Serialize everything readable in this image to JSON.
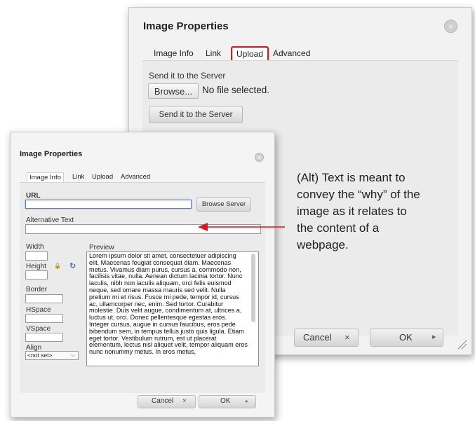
{
  "back_dialog": {
    "title": "Image Properties",
    "tabs": [
      "Image Info",
      "Link",
      "Upload",
      "Advanced"
    ],
    "active_tab": "Upload",
    "send_label": "Send it to the Server",
    "browse_label": "Browse...",
    "file_status": "No file selected.",
    "send_button_label": "Send it to the Server",
    "cancel_label": "Cancel",
    "cancel_icon": "×",
    "ok_label": "OK",
    "ok_icon": "▸"
  },
  "front_dialog": {
    "title": "Image Properties",
    "tabs": [
      "Image Info",
      "Link",
      "Upload",
      "Advanced"
    ],
    "active_tab": "Image Info",
    "url_label": "URL",
    "url_value": "",
    "browse_server_label": "Browse Server",
    "alt_text_label": "Alternative Text",
    "alt_text_value": "",
    "width_label": "Width",
    "height_label": "Height",
    "border_label": "Border",
    "hspace_label": "HSpace",
    "vspace_label": "VSpace",
    "align_label": "Align",
    "align_value": "<not set>",
    "preview_label": "Preview",
    "preview_text": "Lorem ipsum dolor sit amet, consectetuer adipiscing elit. Maecenas feugiat consequat diam. Maecenas metus. Vivamus diam purus, cursus a, commodo non, facilisis vitae, nulla. Aenean dictum lacinia tortor. Nunc iaculis, nibh non iaculis aliquam, orci felis euismod neque, sed ornare massa mauris sed velit. Nulla pretium mi et risus. Fusce mi pede, tempor id, cursus ac, ullamcorper nec, enim. Sed tortor. Curabitur molestie. Duis velit augue, condimentum at, ultrices a, luctus ut, orci. Donec pellentesque egestas eros. Integer cursus, augue in cursus faucibus, eros pede bibendum sem, in tempus tellus justo quis ligula. Etiam eget tortor. Vestibulum rutrum, est ut placerat elementum, lectus nisl aliquet velit, tempor aliquam eros nunc nonummy metus. In eros metus,",
    "cancel_label": "Cancel",
    "cancel_icon": "×",
    "ok_label": "OK",
    "ok_icon": "▸"
  },
  "annotation": {
    "text": "(Alt) Text is meant to convey the “why” of the image as it relates to the content of a webpage.",
    "arrow_color": "#e0141e",
    "highlight_color": "#e0141e"
  }
}
